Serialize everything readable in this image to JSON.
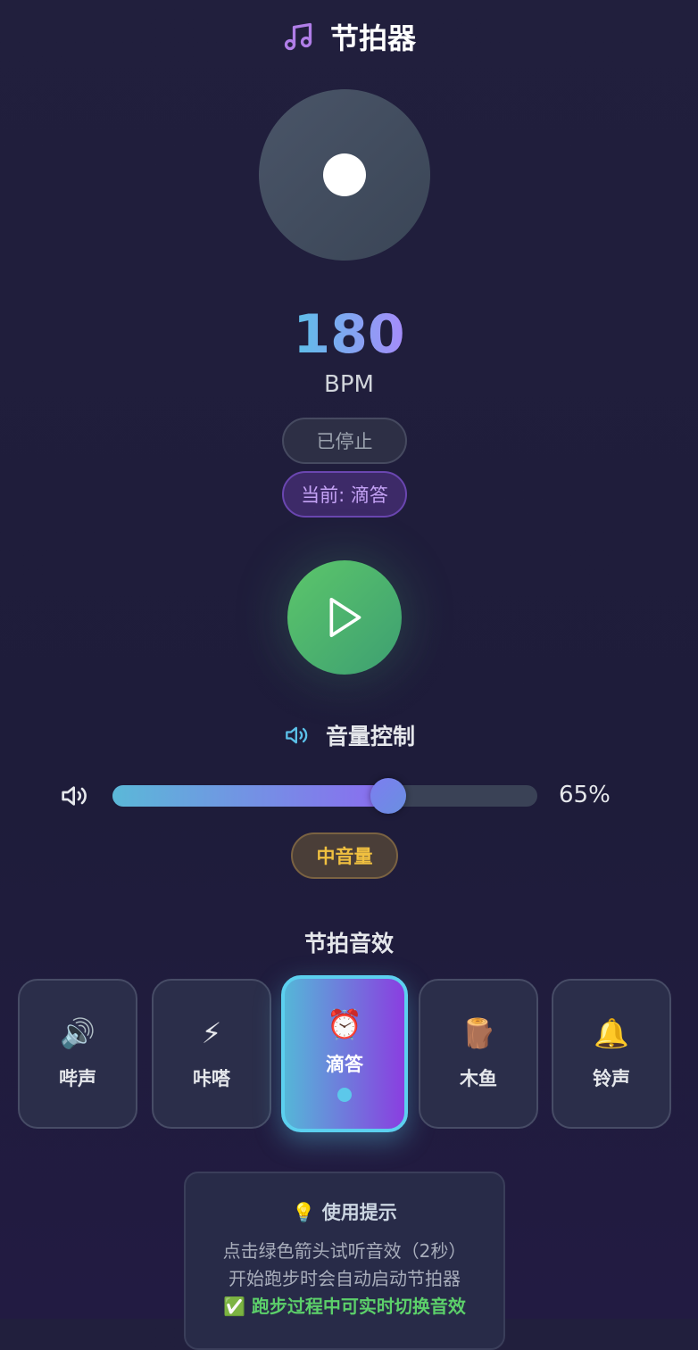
{
  "header": {
    "title": "节拍器",
    "icon": "music-note-icon"
  },
  "bpm": {
    "value": "180",
    "unit": "BPM"
  },
  "status": {
    "state": "已停止",
    "current": "当前: 滴答"
  },
  "play": {
    "icon": "play-icon"
  },
  "volume": {
    "title": "音量控制",
    "value_percent": 65,
    "label": "65%",
    "level": "中音量"
  },
  "sounds": {
    "title": "节拍音效",
    "items": [
      {
        "emoji": "🔊",
        "label": "哔声"
      },
      {
        "emoji": "⚡",
        "label": "咔嗒"
      },
      {
        "emoji": "⏰",
        "label": "滴答",
        "selected": true
      },
      {
        "emoji": "🪵",
        "label": "木鱼"
      },
      {
        "emoji": "🔔",
        "label": "铃声"
      }
    ]
  },
  "tips": {
    "title": "💡 使用提示",
    "lines": [
      "点击绿色箭头试听音效（2秒）",
      "开始跑步时会自动启动节拍器",
      "✅ 跑步过程中可实时切换音效"
    ]
  },
  "colors": {
    "accent": "#8b5cf6",
    "play": "#4caf6a",
    "selected_border": "#5cd0ef",
    "level": "#f0c040"
  }
}
